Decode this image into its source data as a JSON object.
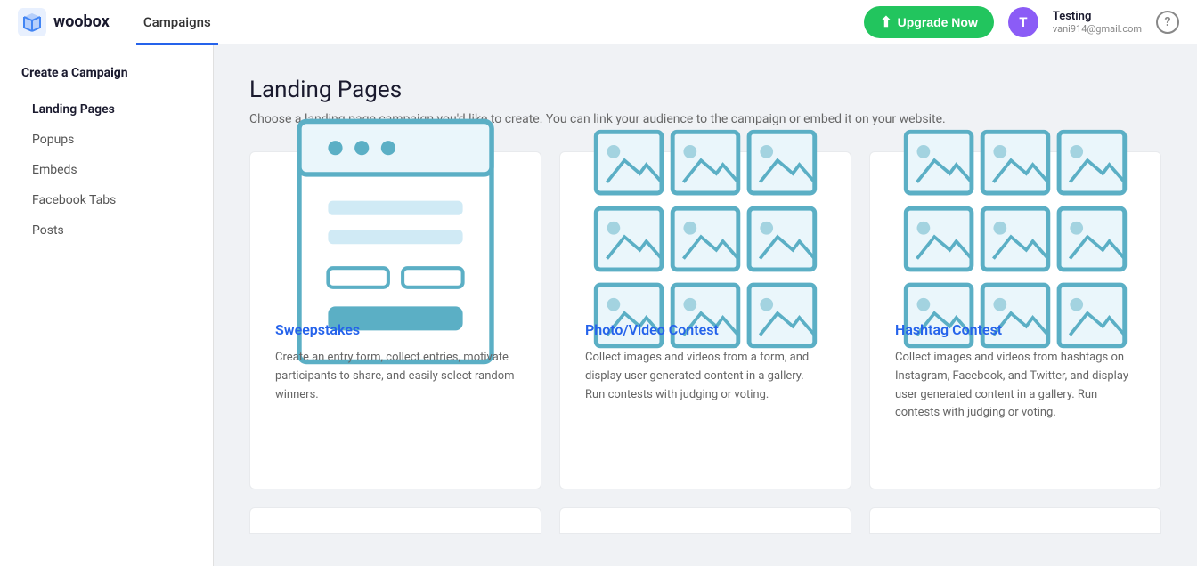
{
  "header": {
    "logo_text": "woobox",
    "nav_campaigns": "Campaigns",
    "upgrade_btn": "Upgrade Now",
    "user_name": "Testing",
    "user_email": "vani914@gmail.com",
    "user_initial": "T",
    "help_label": "?"
  },
  "sidebar": {
    "heading": "Create a Campaign",
    "items": [
      {
        "label": "Landing Pages",
        "active": true
      },
      {
        "label": "Popups",
        "active": false
      },
      {
        "label": "Embeds",
        "active": false
      },
      {
        "label": "Facebook Tabs",
        "active": false
      },
      {
        "label": "Posts",
        "active": false
      }
    ]
  },
  "main": {
    "title": "Landing Pages",
    "subtitle": "Choose a landing page campaign you'd like to create. You can link your audience to the campaign or embed it on your website.",
    "cards": [
      {
        "id": "sweepstakes",
        "title": "Sweepstakes",
        "desc": "Create an entry form, collect entries, motivate participants to share, and easily select random winners."
      },
      {
        "id": "photo-video-contest",
        "title": "Photo/Video Contest",
        "desc": "Collect images and videos from a form, and display user generated content in a gallery. Run contests with judging or voting."
      },
      {
        "id": "hashtag-contest",
        "title": "Hashtag Contest",
        "desc": "Collect images and videos from hashtags on Instagram, Facebook, and Twitter, and display user generated content in a gallery. Run contests with judging or voting."
      }
    ]
  }
}
